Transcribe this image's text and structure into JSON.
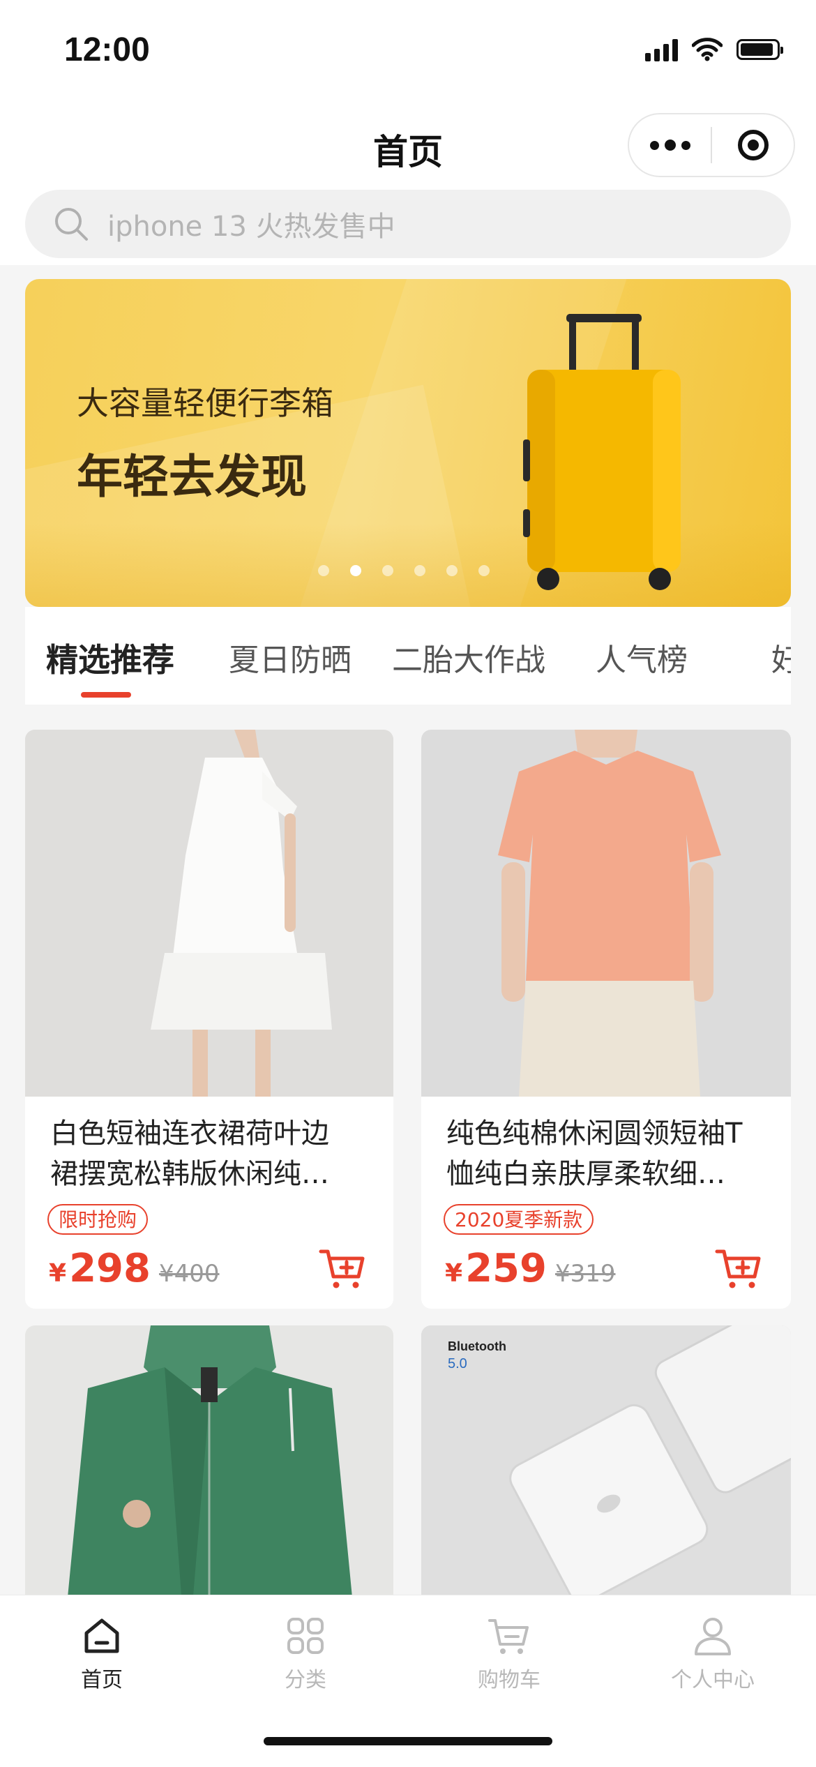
{
  "status_bar": {
    "time": "12:00"
  },
  "nav": {
    "title": "首页"
  },
  "search": {
    "placeholder": "iphone 13 火热发售中"
  },
  "banner": {
    "subtitle": "大容量轻便行李箱",
    "title": "年轻去发现",
    "dot_count": 6,
    "active_dot": 2
  },
  "tabs": [
    {
      "label": "精选推荐",
      "active": true
    },
    {
      "label": "夏日防晒"
    },
    {
      "label": "二胎大作战"
    },
    {
      "label": "人气榜"
    },
    {
      "label": "好"
    }
  ],
  "products": [
    {
      "title_line1": "白色短袖连衣裙荷叶边",
      "title_line2": "裙摆宽松韩版休闲纯…",
      "tag": "限时抢购",
      "currency": "¥",
      "price": "298",
      "original_price": "¥400"
    },
    {
      "title_line1": "纯色纯棉休闲圆领短袖T",
      "title_line2": "恤纯白亲肤厚柔软细…",
      "tag": "2020夏季新款",
      "currency": "¥",
      "price": "259",
      "original_price": "¥319"
    },
    {
      "image": "green-hoodie"
    },
    {
      "image": "white-bluetooth-devices",
      "image_text_brand": "Bluetooth",
      "image_text_version": "5.0"
    }
  ],
  "tab_bar": [
    {
      "label": "首页",
      "icon": "home-icon",
      "active": true
    },
    {
      "label": "分类",
      "icon": "grid-icon"
    },
    {
      "label": "购物车",
      "icon": "cart-icon"
    },
    {
      "label": "个人中心",
      "icon": "user-icon"
    }
  ],
  "colors": {
    "accent": "#e8412c",
    "banner_bg": "#f6cf55"
  }
}
